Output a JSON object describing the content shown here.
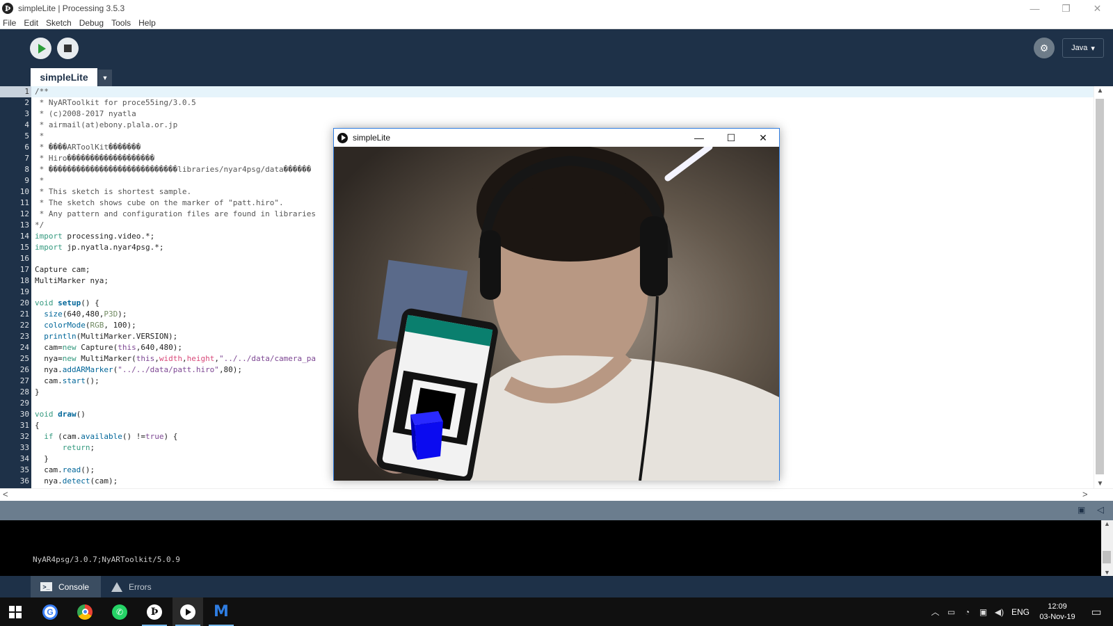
{
  "window": {
    "title": "simpleLite | Processing 3.5.3",
    "app_icon": "processing-p3-icon",
    "minimize": "—",
    "restore": "❐",
    "close": "✕"
  },
  "menu": [
    "File",
    "Edit",
    "Sketch",
    "Debug",
    "Tools",
    "Help"
  ],
  "toolbar": {
    "mode": "Java",
    "mode_arrow": "▾",
    "debug_glyph": "⚙"
  },
  "tabs": {
    "active": "simpleLite",
    "menu_arrow": "▼"
  },
  "editor": {
    "current_line": 1,
    "lines": [
      "/**",
      " * NyARToolkit for proce55ing/3.0.5",
      " * (c)2008-2017 nyatla",
      " * airmail(at)ebony.plala.or.jp",
      " *",
      " * ����ARToolKit�������",
      " * Hiro�������������������",
      " * ����������������������������libraries/nyar4psg/data������",
      " *",
      " * This sketch is shortest sample.",
      " * The sketch shows cube on the marker of \"patt.hiro\".",
      " * Any pattern and configuration files are found in libraries",
      "*/",
      "import processing.video.*;",
      "import jp.nyatla.nyar4psg.*;",
      "",
      "Capture cam;",
      "MultiMarker nya;",
      "",
      "void setup() {",
      "  size(640,480,P3D);",
      "  colorMode(RGB, 100);",
      "  println(MultiMarker.VERSION);",
      "  cam=new Capture(this,640,480);",
      "  nya=new MultiMarker(this,width,height,\"../../data/camera_pa",
      "  nya.addARMarker(\"../../data/patt.hiro\",80);",
      "  cam.start();",
      "}",
      "",
      "void draw()",
      "{",
      "  if (cam.available() !=true) {",
      "      return;",
      "  }",
      "  cam.read();",
      "  nya.detect(cam);"
    ]
  },
  "scroll": {
    "up": "▲",
    "down": "▼",
    "left": "<",
    "right": ">"
  },
  "console": {
    "output": "NyAR4psg/3.0.7;NyARToolkit/5.0.9",
    "tabs": [
      {
        "label": "Console",
        "icon": "console-icon"
      },
      {
        "label": "Errors",
        "icon": "warning-icon"
      }
    ]
  },
  "sketch_window": {
    "title": "simpleLite",
    "minimize": "—",
    "maximize": "☐",
    "close": "✕",
    "content": "webcam-feed-with-ar-cube"
  },
  "taskbar": {
    "apps": [
      "windows-start-icon",
      "google-icon",
      "chrome-icon",
      "whatsapp-icon",
      "processing-icon",
      "sketch-run-icon",
      "malwarebytes-icon"
    ],
    "tray": {
      "language": "ENG",
      "time": "12:09",
      "date": "03-Nov-19"
    }
  },
  "colors": {
    "toolbar_bg": "#1e3148",
    "run_green": "#2b9d39",
    "console_bg": "#000000",
    "cube_blue": "#1010e0"
  }
}
